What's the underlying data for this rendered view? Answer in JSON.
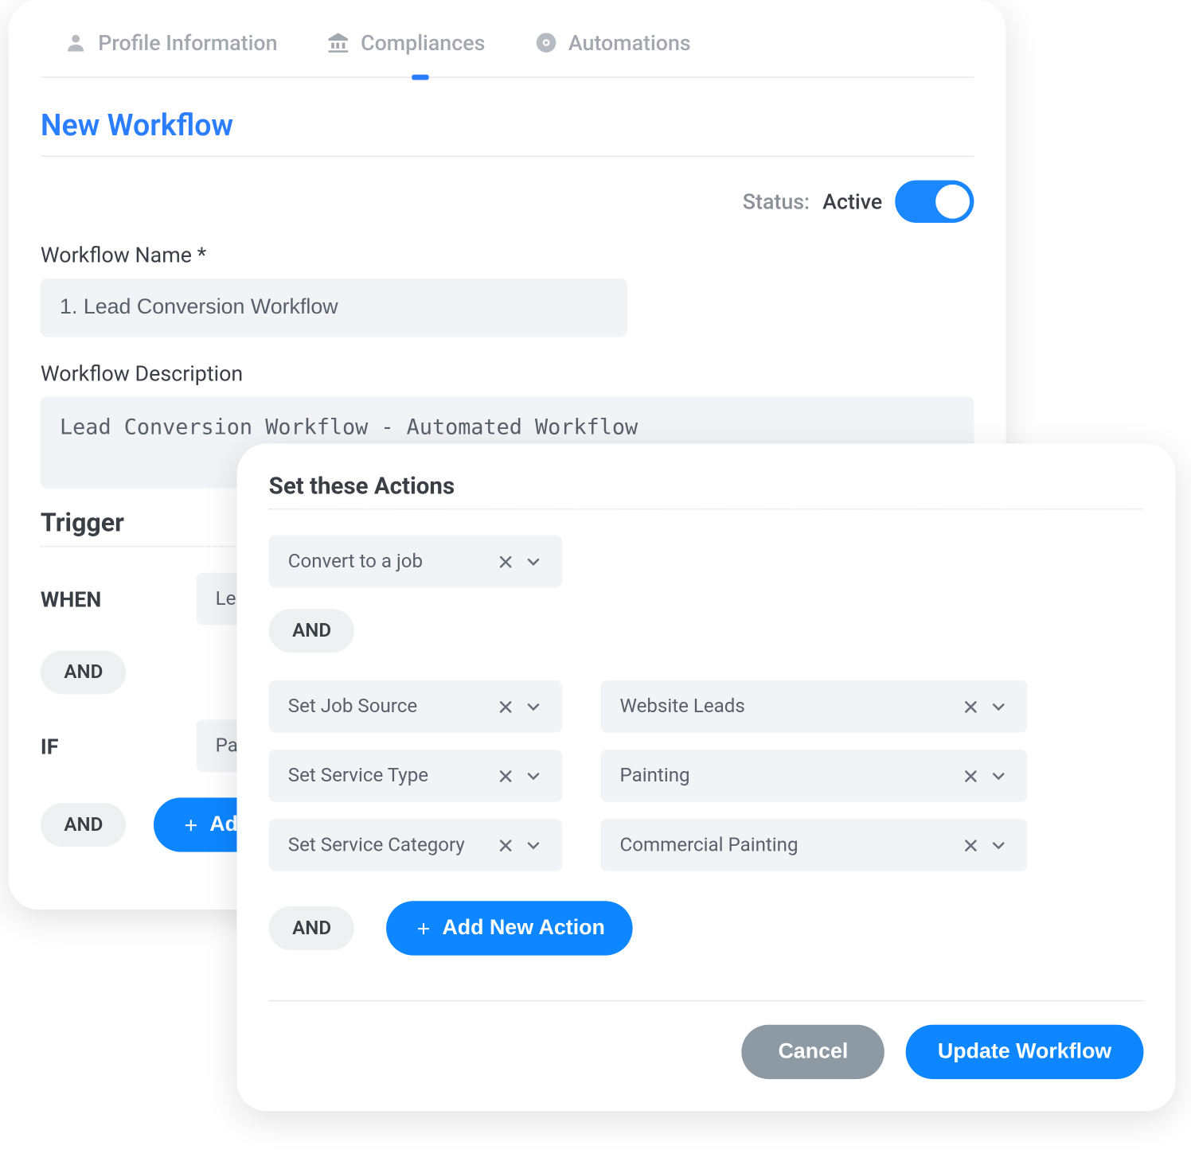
{
  "tabs": {
    "profile": "Profile Information",
    "compliances": "Compliances",
    "automations": "Automations"
  },
  "page_title": "New Workflow",
  "status": {
    "label": "Status:",
    "value": "Active"
  },
  "form": {
    "name_label": "Workflow Name *",
    "name_value": "1. Lead Conversion Workflow",
    "desc_label": "Workflow Description",
    "desc_value": "Lead Conversion Workflow - Automated Workflow"
  },
  "trigger": {
    "title": "Trigger",
    "when_label": "WHEN",
    "when_value": "Lea",
    "and1": "AND",
    "if_label": "IF",
    "if_value": "Pay",
    "and2": "AND",
    "add_condition": "Add"
  },
  "actions": {
    "title": "Set these Actions",
    "items": [
      {
        "action": "Convert to a job"
      }
    ],
    "and_mid": "AND",
    "pairs": [
      {
        "action": "Set Job Source",
        "value": "Website Leads"
      },
      {
        "action": "Set Service Type",
        "value": "Painting"
      },
      {
        "action": "Set Service Category",
        "value": "Commercial Painting"
      }
    ],
    "and_bottom": "AND",
    "add_action": "Add New Action"
  },
  "footer": {
    "cancel": "Cancel",
    "update": "Update Workflow"
  }
}
